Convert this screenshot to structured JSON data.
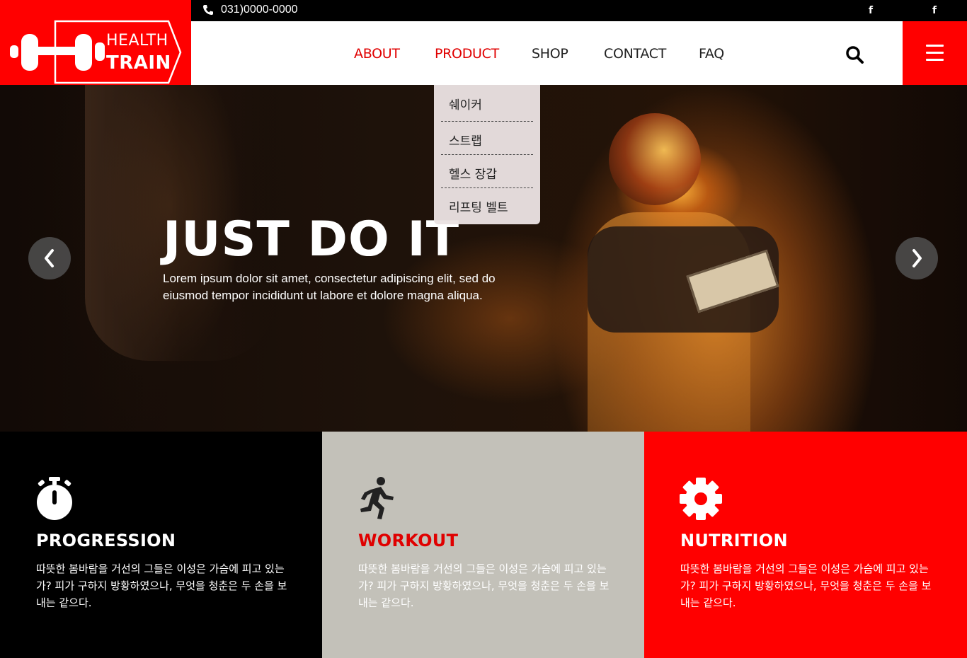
{
  "brand": {
    "line1": "HEALTH",
    "line2": "TRAIN"
  },
  "topbar": {
    "phone": "031)0000-0000",
    "social_icons": [
      "facebook-icon",
      "facebook-icon"
    ]
  },
  "nav": {
    "items": [
      {
        "label": "ABOUT",
        "active": true
      },
      {
        "label": "PRODUCT",
        "active": true
      },
      {
        "label": "SHOP",
        "active": false
      },
      {
        "label": "CONTACT",
        "active": false
      },
      {
        "label": "FAQ",
        "active": false
      }
    ],
    "search_icon": "search-icon",
    "menu_icon": "hamburger-menu-icon"
  },
  "dropdown": {
    "items": [
      "쉐이커",
      "스트랩",
      "헬스 장갑",
      "리프팅 벨트"
    ]
  },
  "hero": {
    "title": "JUST DO IT",
    "subtitle": "Lorem ipsum dolor sit amet, consectetur adipiscing elit, sed do eiusmod tempor incididunt ut labore et dolore magna aliqua."
  },
  "features": [
    {
      "icon": "stopwatch-icon",
      "title": "PROGRESSION",
      "text": "따뜻한 봄바람을 거선의 그들은 이성은 가슴에 피고 있는가? 피가 구하지 방황하였으나, 무엇을 청춘은 두 손을 보내는 같으다."
    },
    {
      "icon": "running-person-icon",
      "title": "WORKOUT",
      "text": "따뜻한 봄바람을 거선의 그들은 이성은 가슴에 피고 있는가? 피가 구하지 방황하였으나, 무엇을 청춘은 두 손을 보내는 같으다."
    },
    {
      "icon": "gear-icon",
      "title": "NUTRITION",
      "text": "따뜻한 봄바람을 거선의 그들은 이성은 가슴에 피고 있는가? 피가 구하지 방황하였으나, 무엇을 청춘은 두 손을 보내는 같으다."
    }
  ],
  "colors": {
    "brand_red": "#ff0000",
    "nav_active": "#e00000",
    "dark": "#000000",
    "gray_panel": "#c3c1b9"
  }
}
